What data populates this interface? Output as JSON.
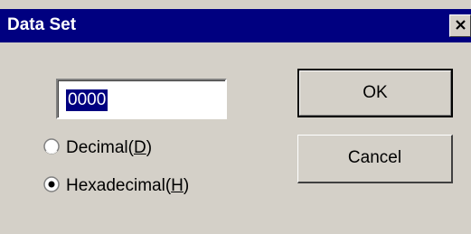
{
  "window": {
    "title": "Data Set"
  },
  "input": {
    "value": "0000"
  },
  "radios": {
    "decimal_label": "Decimal(",
    "decimal_key": "D",
    "decimal_suffix": ")",
    "decimal_selected": false,
    "hex_label": "Hexadecimal(",
    "hex_key": "H",
    "hex_suffix": ")",
    "hex_selected": true
  },
  "buttons": {
    "ok_label": "OK",
    "cancel_label": "Cancel"
  },
  "icons": {
    "close": "close-icon",
    "radio_unchecked": "radio-unchecked-icon",
    "radio_checked": "radio-checked-icon"
  },
  "colors": {
    "titlebar": "#000080",
    "face": "#d4d0c8",
    "selection": "#000080"
  }
}
